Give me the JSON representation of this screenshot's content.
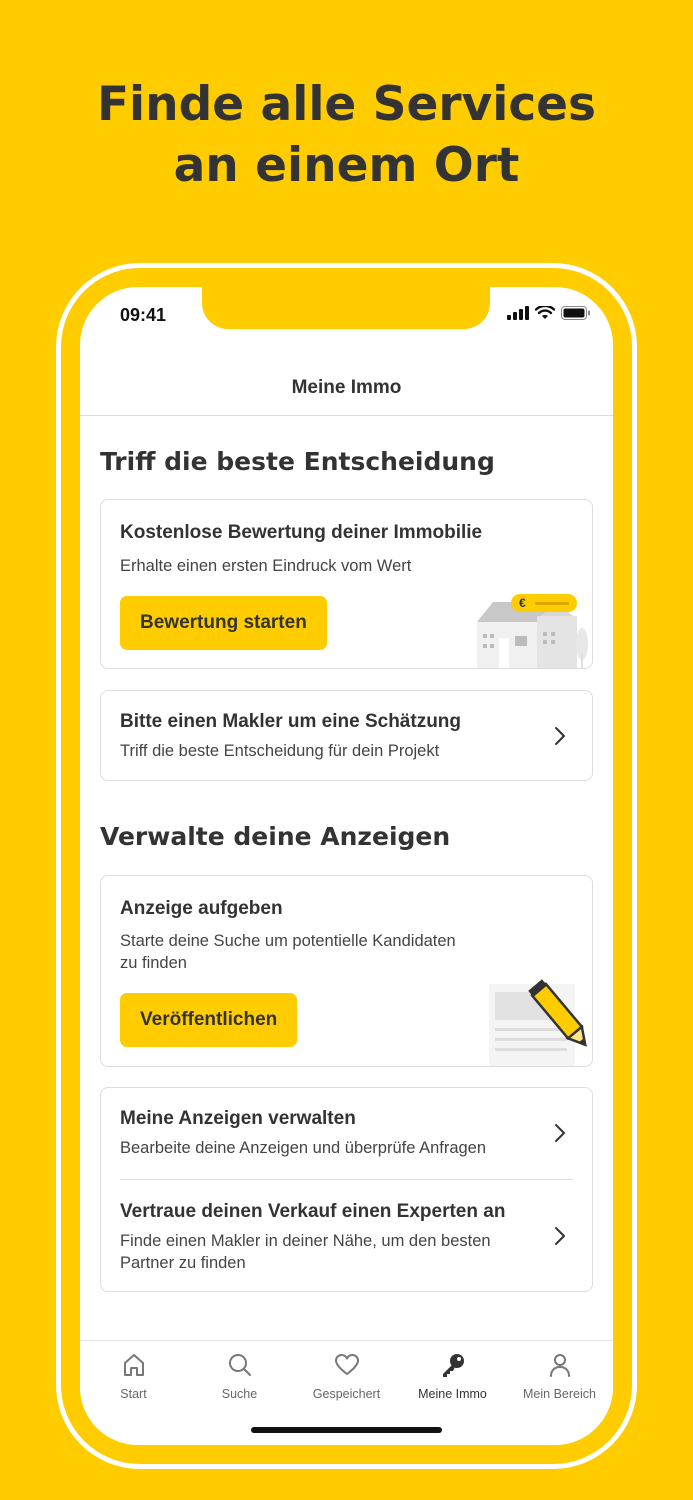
{
  "headline": {
    "line1": "Finde alle Services",
    "line2": "an einem Ort"
  },
  "status_bar": {
    "time": "09:41"
  },
  "nav": {
    "title": "Meine Immo"
  },
  "section1": {
    "title": "Triff die beste Entscheidung",
    "valuation_card": {
      "title": "Kostenlose Bewertung deiner Immobilie",
      "subtitle": "Erhalte einen ersten Eindruck vom Wert",
      "button": "Bewertung starten",
      "currency_symbol": "€"
    },
    "agent_card": {
      "title": "Bitte einen Makler um eine Schätzung",
      "subtitle": "Triff die beste Entscheidung für dein Projekt"
    }
  },
  "section2": {
    "title": "Verwalte deine Anzeigen",
    "listing_card": {
      "title": "Anzeige aufgeben",
      "subtitle_line1": "Starte deine Suche um potentielle Kandidaten",
      "subtitle_line2": "zu finden",
      "button": "Veröffentlichen"
    },
    "manage_card": {
      "rows": [
        {
          "title": "Meine Anzeigen verwalten",
          "subtitle": "Bearbeite deine Anzeigen und überprüfe Anfragen"
        },
        {
          "title": "Vertraue deinen Verkauf einen Experten an",
          "subtitle_line1": "Finde einen Makler in deiner Nähe, um den besten",
          "subtitle_line2": "Partner zu finden"
        }
      ]
    }
  },
  "tabbar": {
    "items": [
      {
        "label": "Start",
        "icon": "home-icon"
      },
      {
        "label": "Suche",
        "icon": "search-icon"
      },
      {
        "label": "Gespeichert",
        "icon": "heart-icon"
      },
      {
        "label": "Meine Immo",
        "icon": "key-icon",
        "active": true
      },
      {
        "label": "Mein Bereich",
        "icon": "person-icon"
      }
    ]
  },
  "colors": {
    "brand_yellow": "#FFCC00",
    "text_dark": "#333333",
    "border": "#DDDDDD"
  }
}
